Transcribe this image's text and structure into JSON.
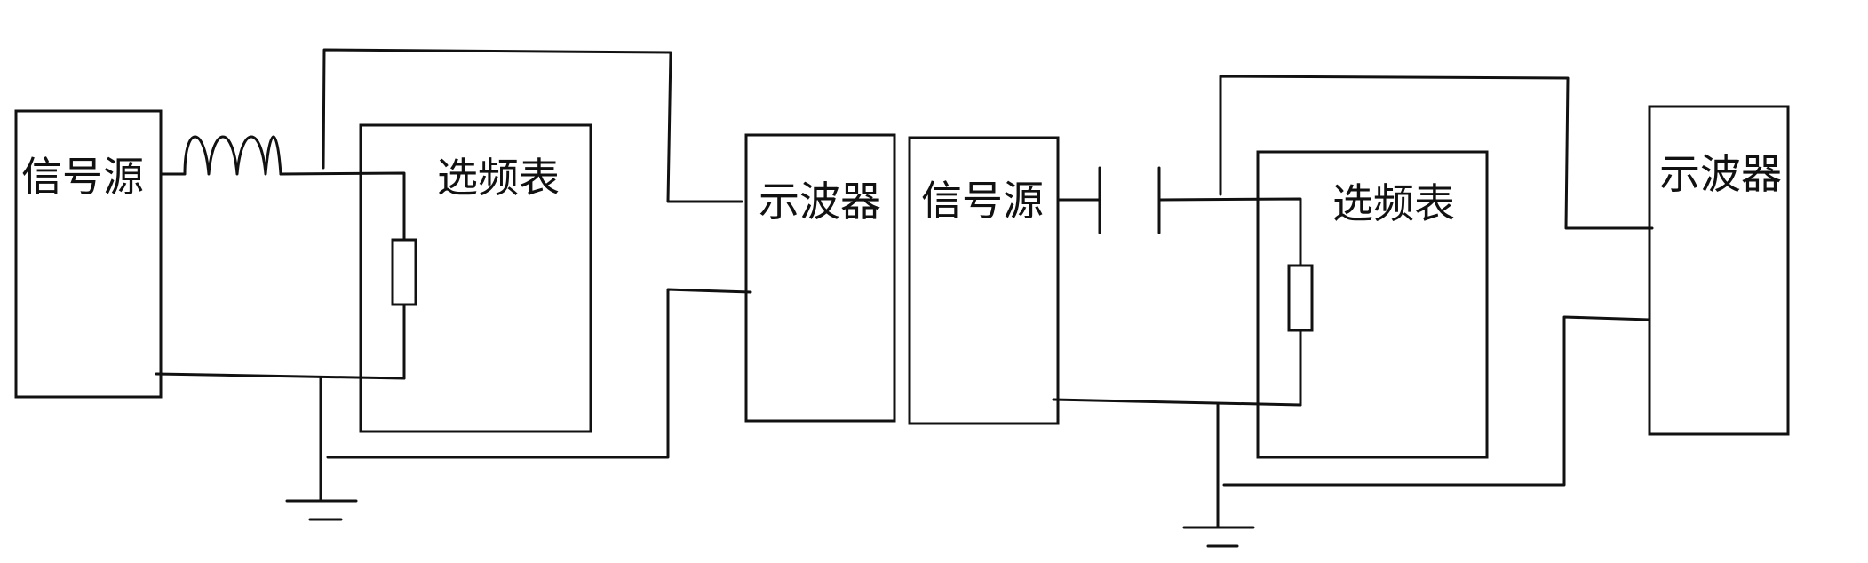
{
  "circuits": [
    {
      "reactive_component": "inductor",
      "signal_source_label": "信号源",
      "selective_meter_label": "选频表",
      "oscilloscope_label": "示波器"
    },
    {
      "reactive_component": "capacitor",
      "signal_source_label": "信号源",
      "selective_meter_label": "选频表",
      "oscilloscope_label": "示波器"
    }
  ]
}
